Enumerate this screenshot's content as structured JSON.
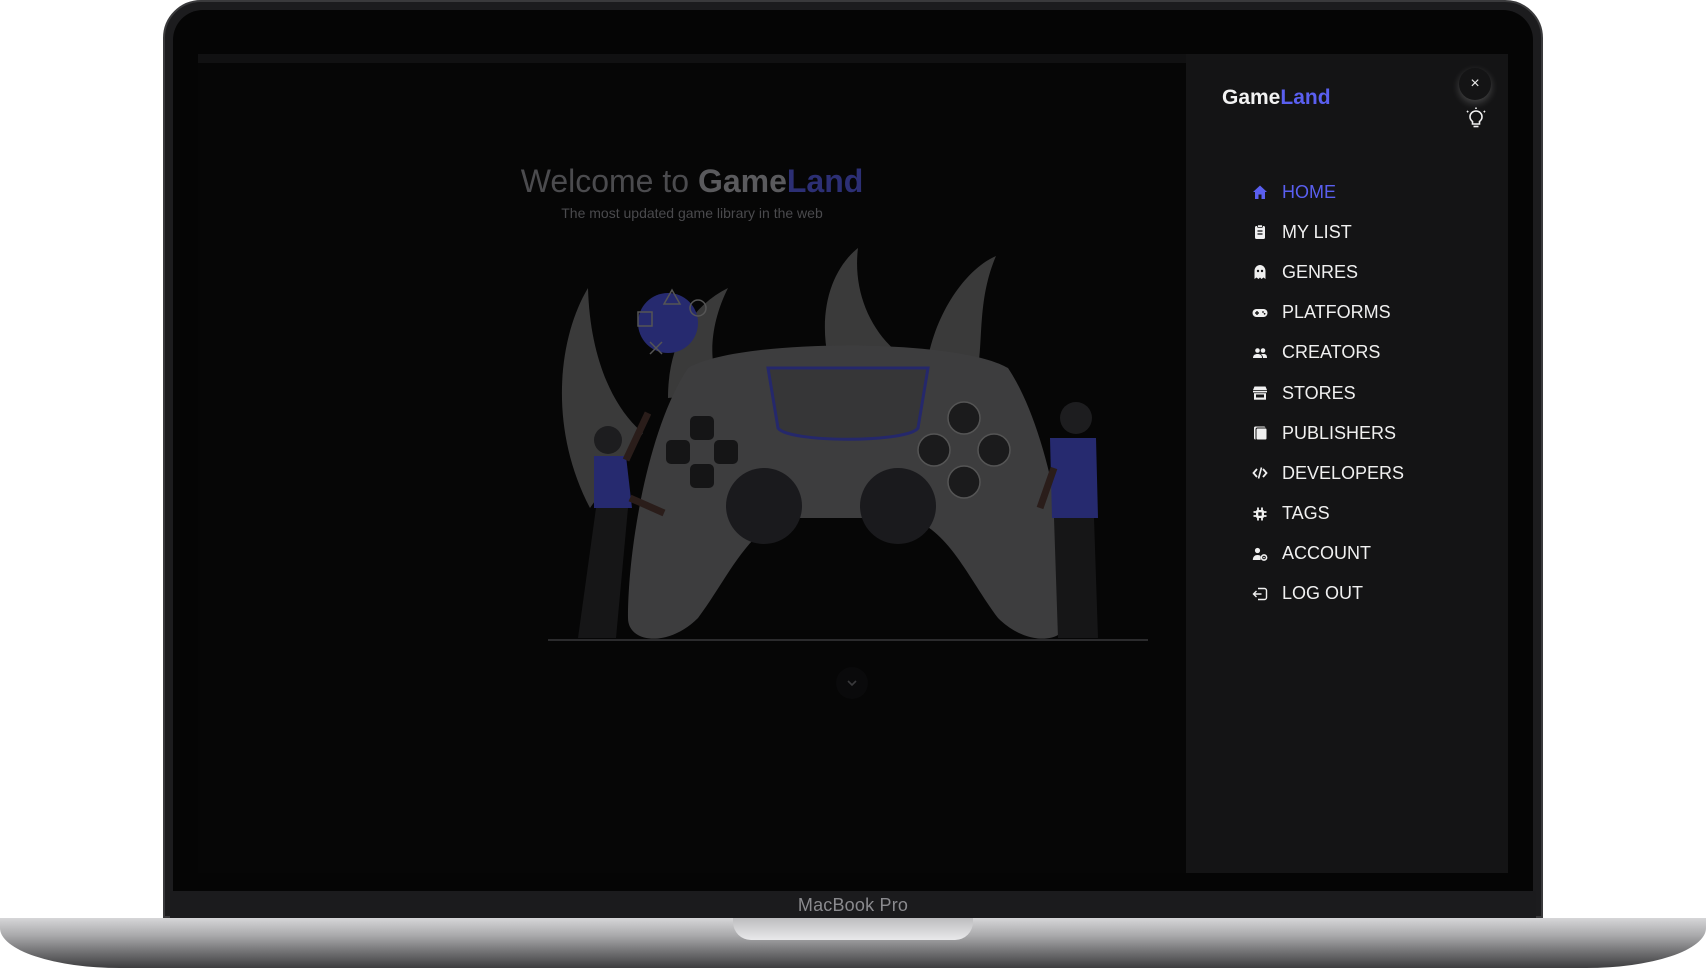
{
  "device": {
    "label": "MacBook Pro"
  },
  "hero": {
    "title_prefix": "Welcome to ",
    "title_brand_a": "Game",
    "title_brand_b": "Land",
    "subtitle": "The most updated game library in the web"
  },
  "sidebar": {
    "logo_a": "Game",
    "logo_b": "Land",
    "close_label": "×",
    "accent_color": "#5a5ff0",
    "items": [
      {
        "label": "HOME",
        "icon": "home-icon",
        "active": true
      },
      {
        "label": "MY LIST",
        "icon": "list-icon",
        "active": false
      },
      {
        "label": "GENRES",
        "icon": "ghost-icon",
        "active": false
      },
      {
        "label": "PLATFORMS",
        "icon": "gamepad-icon",
        "active": false
      },
      {
        "label": "CREATORS",
        "icon": "people-icon",
        "active": false
      },
      {
        "label": "STORES",
        "icon": "store-icon",
        "active": false
      },
      {
        "label": "PUBLISHERS",
        "icon": "book-icon",
        "active": false
      },
      {
        "label": "DEVELOPERS",
        "icon": "code-icon",
        "active": false
      },
      {
        "label": "TAGS",
        "icon": "tags-icon",
        "active": false
      },
      {
        "label": "ACCOUNT",
        "icon": "user-gear-icon",
        "active": false
      },
      {
        "label": "LOG OUT",
        "icon": "logout-icon",
        "active": false
      }
    ]
  }
}
